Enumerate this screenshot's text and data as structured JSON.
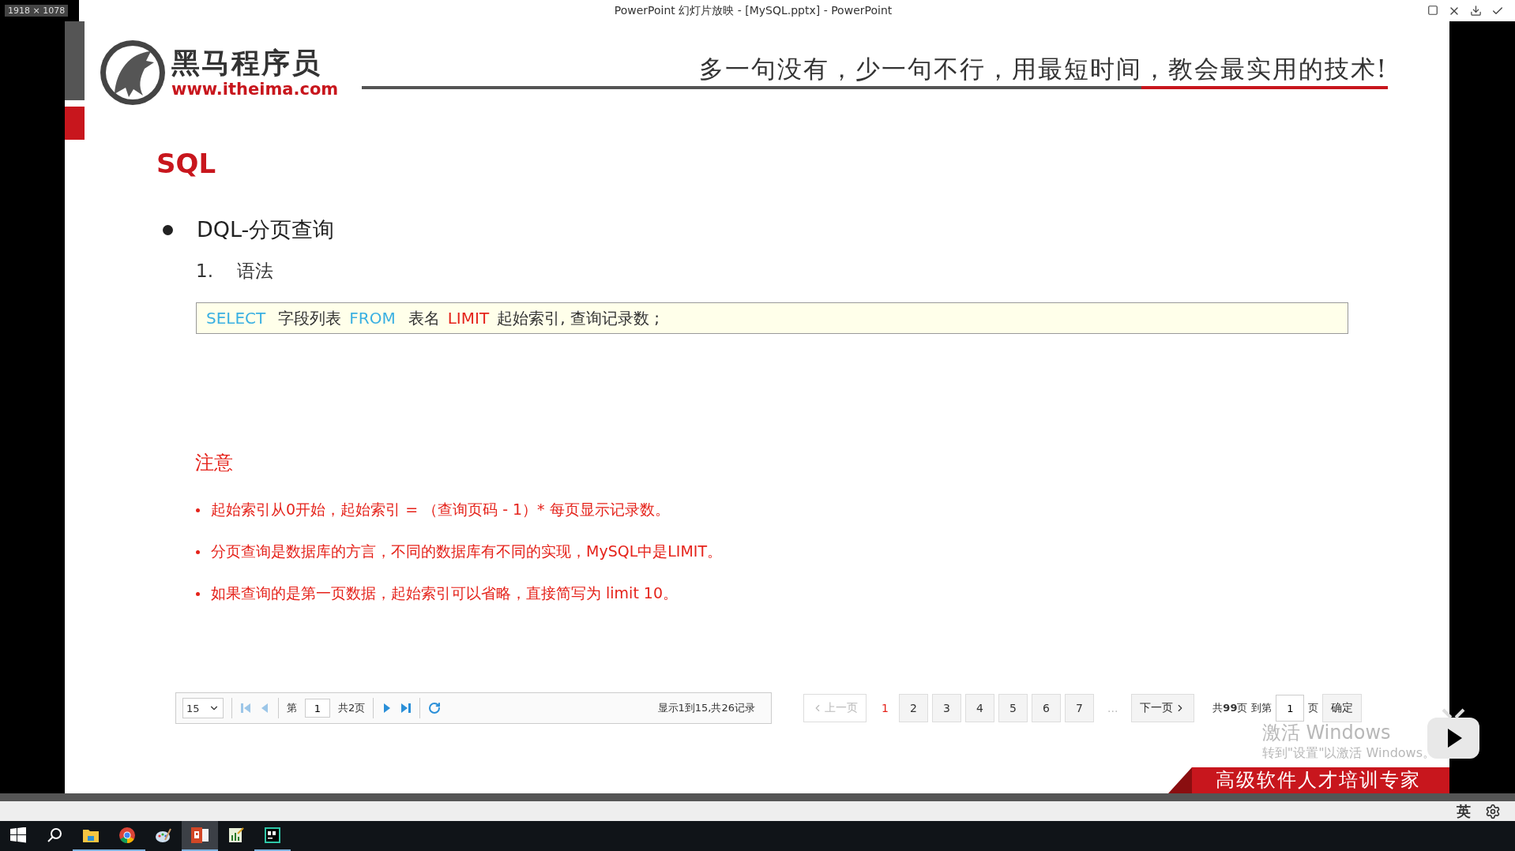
{
  "window": {
    "badge": "1918 × 1078",
    "title": "PowerPoint 幻灯片放映 - [MySQL.pptx] - PowerPoint"
  },
  "slide": {
    "logo": {
      "name": "黑马程序员",
      "url": "www.itheima.com"
    },
    "slogan": "多一句没有，少一句不行，用最短时间，教会最实用的技术!",
    "heading": "SQL",
    "bullet": "DQL-分页查询",
    "step": {
      "number": "1.",
      "label": "语法"
    },
    "code": [
      {
        "text": "SELECT",
        "kind": "keyword"
      },
      {
        "text": "字段列表",
        "kind": "plain"
      },
      {
        "text": "FROM",
        "kind": "keyword"
      },
      {
        "text": "表名",
        "kind": "plain"
      },
      {
        "text": "LIMIT",
        "kind": "limit"
      },
      {
        "text": "起始索引, 查询记录数 ;",
        "kind": "plain"
      }
    ],
    "note_title": "注意",
    "notes": [
      "起始索引从0开始，起始索引 = （查询页码 - 1）* 每页显示记录数。",
      "分页查询是数据库的方言，不同的数据库有不同的实现，MySQL中是LIMIT。",
      "如果查询的是第一页数据，起始索引可以省略，直接简写为 limit 10。"
    ],
    "grid_pager": {
      "page_size": "15",
      "page_label": "第",
      "page": "1",
      "total_pages": "共2页",
      "summary": "显示1到15,共26记录"
    },
    "pager": {
      "prev": "上一页",
      "prev_disabled": true,
      "pages": [
        {
          "label": "1",
          "selected": true
        },
        {
          "label": "2",
          "selected": false
        },
        {
          "label": "3",
          "selected": false
        },
        {
          "label": "4",
          "selected": false
        },
        {
          "label": "5",
          "selected": false
        },
        {
          "label": "6",
          "selected": false
        },
        {
          "label": "7",
          "selected": false
        }
      ],
      "ellipsis": "...",
      "next": "下一页",
      "total": "共**99**页",
      "goto_label": "到第",
      "goto_value": "1",
      "page_suffix": "页",
      "confirm": "确定"
    },
    "banner": "高级软件人才培训专家",
    "activation": {
      "title": "激活 Windows",
      "hint": "转到\"设置\"以激活 Windows。"
    }
  },
  "tray": {
    "ime": "英"
  },
  "taskbar": [
    {
      "kind": "start",
      "active": false,
      "running": false
    },
    {
      "kind": "search",
      "active": false,
      "running": false
    },
    {
      "kind": "folder",
      "active": false,
      "running": true
    },
    {
      "kind": "browser",
      "active": false,
      "running": true
    },
    {
      "kind": "paint",
      "active": false,
      "running": false
    },
    {
      "kind": "slides",
      "active": true,
      "running": true
    },
    {
      "kind": "chart",
      "active": false,
      "running": false
    },
    {
      "kind": "db",
      "active": false,
      "running": true
    }
  ]
}
